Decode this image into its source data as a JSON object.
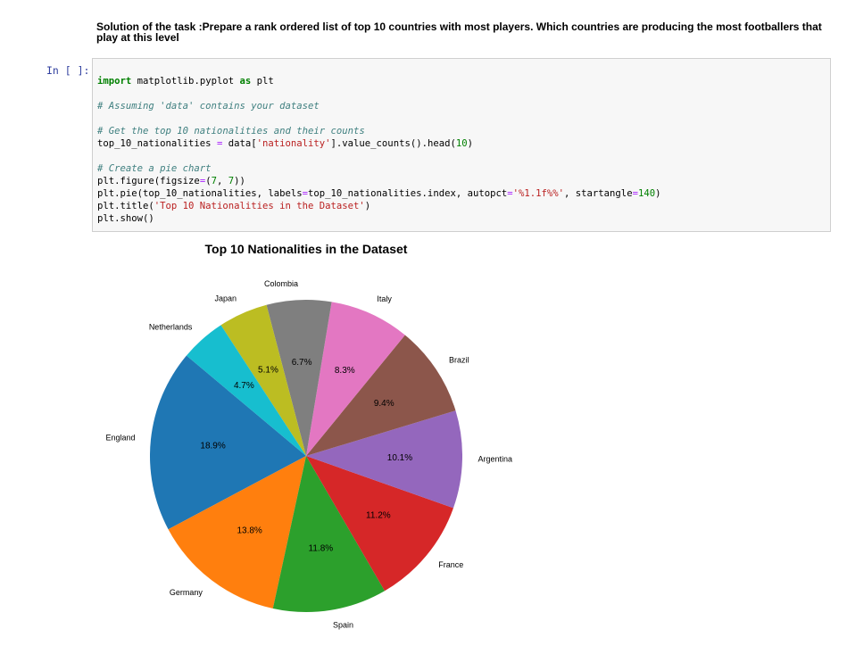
{
  "markdown": {
    "text": "Solution of the task :Prepare a rank ordered list of top 10 countries with most players. Which countries are producing the most footballers that play at this level"
  },
  "cell": {
    "prompt": "In [ ]:",
    "code": {
      "kw_import": "import",
      "mod": " matplotlib.pyplot ",
      "kw_as": "as",
      "alias": " plt",
      "comment1": "# Assuming 'data' contains your dataset",
      "comment2": "# Get the top 10 nationalities and their counts",
      "l4_a": "top_10_nationalities ",
      "l4_eq": "=",
      "l4_b": " data[",
      "l4_str": "'nationality'",
      "l4_c": "].value_counts().head(",
      "l4_num": "10",
      "l4_d": ")",
      "comment3": "# Create a pie chart",
      "l6_a": "plt.figure(figsize",
      "l6_eq": "=",
      "l6_b": "(",
      "l6_n1": "7",
      "l6_c": ", ",
      "l6_n2": "7",
      "l6_d": "))",
      "l7_a": "plt.pie(top_10_nationalities, labels",
      "l7_eq1": "=",
      "l7_b": "top_10_nationalities.index, autopct",
      "l7_eq2": "=",
      "l7_str": "'%1.1f%%'",
      "l7_c": ", startangle",
      "l7_eq3": "=",
      "l7_num": "140",
      "l7_d": ")",
      "l8_a": "plt.title(",
      "l8_str": "'Top 10 Nationalities in the Dataset'",
      "l8_b": ")",
      "l9": "plt.show()"
    }
  },
  "chart_data": {
    "type": "pie",
    "title": "Top 10 Nationalities in the Dataset",
    "startangle": 140,
    "counterclock": true,
    "categories": [
      "England",
      "Germany",
      "Spain",
      "France",
      "Argentina",
      "Brazil",
      "Italy",
      "Colombia",
      "Japan",
      "Netherlands"
    ],
    "values": [
      18.9,
      13.8,
      11.8,
      11.2,
      10.1,
      9.4,
      8.3,
      6.7,
      5.1,
      4.7
    ],
    "pct_labels": [
      "18.9%",
      "13.8%",
      "11.8%",
      "11.2%",
      "10.1%",
      "9.4%",
      "8.3%",
      "6.7%",
      "5.1%",
      "4.7%"
    ],
    "colors": [
      "#1f77b4",
      "#ff7f0e",
      "#2ca02c",
      "#d62728",
      "#9467bd",
      "#8c564b",
      "#e377c2",
      "#7f7f7f",
      "#bcbd22",
      "#17becf"
    ]
  }
}
